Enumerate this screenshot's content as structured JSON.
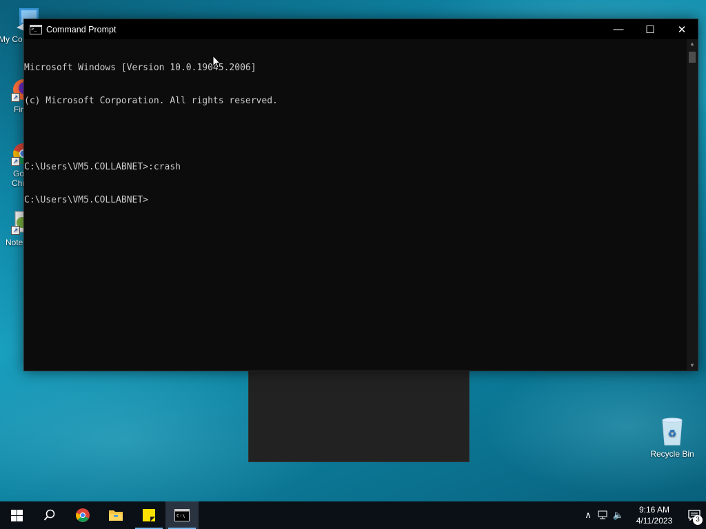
{
  "desktop": {
    "icons": [
      {
        "label": "My Co",
        "icon": "computer-icon"
      },
      {
        "label": "Fir",
        "icon": "firefox-icon"
      },
      {
        "label": "Go",
        "label2": "Chr",
        "icon": "chrome-icon"
      },
      {
        "label": "Note",
        "icon": "notepad-plus-icon"
      },
      {
        "label": "Recycle Bin",
        "icon": "recycle-bin-icon"
      }
    ]
  },
  "window": {
    "title": "Command Prompt",
    "buttons": {
      "minimize": "—",
      "maximize": "☐",
      "close": "✕"
    },
    "console_lines": [
      "Microsoft Windows [Version 10.0.19045.2006]",
      "(c) Microsoft Corporation. All rights reserved.",
      "",
      "C:\\Users\\VM5.COLLABNET>:crash",
      "C:\\Users\\VM5.COLLABNET>"
    ]
  },
  "taskbar": {
    "items": [
      "start-icon",
      "search-icon",
      "chrome-icon",
      "file-explorer-icon",
      "sticky-notes-icon",
      "command-prompt-icon"
    ],
    "clock": {
      "time": "9:16 AM",
      "date": "4/11/2023"
    },
    "notification_count": "3"
  },
  "colors": {
    "console_bg": "#0c0c0c",
    "console_text": "#cccccc",
    "taskbar": "#0a1016",
    "accent": "#76b9ed"
  }
}
